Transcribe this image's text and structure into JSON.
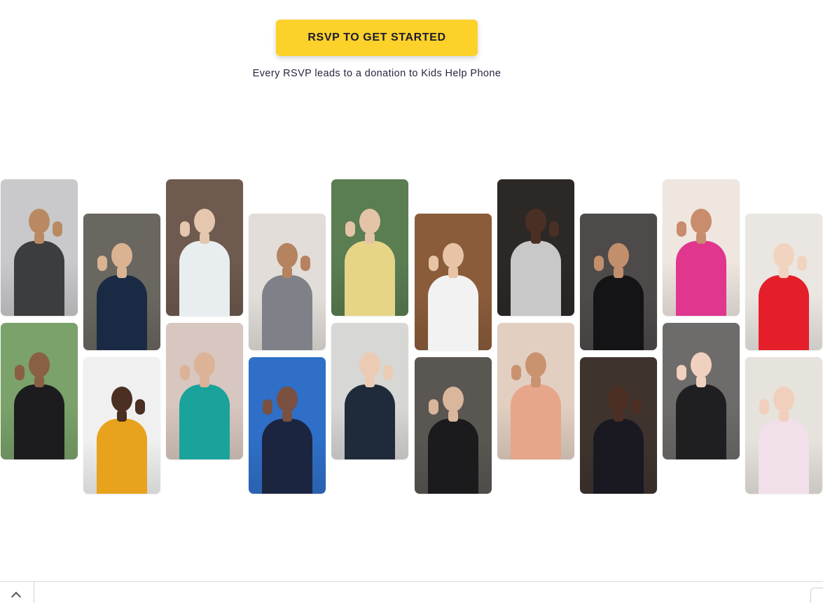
{
  "cta": {
    "label": "RSVP TO GET STARTED"
  },
  "tagline": "Every RSVP leads to a donation to Kids Help Phone",
  "gallery": {
    "photos": [
      {
        "name": "photo-guy-waving-vest",
        "bg": "#c9c9cb",
        "skin": "#b98a62",
        "outfit": "#3b3d3f"
      },
      {
        "name": "photo-girl-black-gown",
        "bg": "#7aa26a",
        "skin": "#8a5f44",
        "outfit": "#1c1c1e"
      },
      {
        "name": "photo-guy-navy-tux",
        "bg": "#6a6660",
        "skin": "#d9b392",
        "outfit": "#1b2a44"
      },
      {
        "name": "photo-girl-striped-blazer",
        "bg": "#f0f0f0",
        "skin": "#4a2f22",
        "outfit": "#e8a21b"
      },
      {
        "name": "photo-girl-white-gown",
        "bg": "#6e5a4e",
        "skin": "#e5c6ae",
        "outfit": "#e8eef0"
      },
      {
        "name": "photo-girl-teal-dress",
        "bg": "#d8c7c0",
        "skin": "#dcb396",
        "outfit": "#1aa39a"
      },
      {
        "name": "photo-guy-grey-suit",
        "bg": "#e2ddd8",
        "skin": "#b5835f",
        "outfit": "#7e8188"
      },
      {
        "name": "photo-girl-navy-dress-sky",
        "bg": "#2f6fc7",
        "skin": "#7a5040",
        "outfit": "#1c2540"
      },
      {
        "name": "photo-girl-floral-gown",
        "bg": "#5a7d52",
        "skin": "#e4c4a6",
        "outfit": "#e6d586"
      },
      {
        "name": "photo-girl-sequin-top",
        "bg": "#d7d7d5",
        "skin": "#eccbb5",
        "outfit": "#1f2a3b"
      },
      {
        "name": "photo-person-suspenders",
        "bg": "#8a5c3a",
        "skin": "#e8c4a6",
        "outfit": "#f2f2f2"
      },
      {
        "name": "photo-guy-black-suit-mirror",
        "bg": "#5a5652",
        "skin": "#d9b69c",
        "outfit": "#1b1b1d"
      },
      {
        "name": "photo-guy-white-hat",
        "bg": "#2c2826",
        "skin": "#4a3024",
        "outfit": "#c9c8c8"
      },
      {
        "name": "photo-girl-peach-gown",
        "bg": "#e2cfc2",
        "skin": "#c99370",
        "outfit": "#e7a58a"
      },
      {
        "name": "photo-girl-black-vneck",
        "bg": "#4e4a4a",
        "skin": "#c28f6c",
        "outfit": "#141416"
      },
      {
        "name": "photo-girl-jeweled-gown",
        "bg": "#3f332e",
        "skin": "#4c2e22",
        "outfit": "#1a1922"
      },
      {
        "name": "photo-girl-pink-saree",
        "bg": "#efe6e0",
        "skin": "#c98c6c",
        "outfit": "#e0368e"
      },
      {
        "name": "photo-guy-curly-hair",
        "bg": "#6e6c6a",
        "skin": "#f0d0be",
        "outfit": "#1f1f22"
      },
      {
        "name": "photo-girl-red-dress",
        "bg": "#eae6e2",
        "skin": "#f1d4c0",
        "outfit": "#e41f2a"
      },
      {
        "name": "photo-girl-sparkle-gown",
        "bg": "#e6e2dc",
        "skin": "#f0d0bc",
        "outfit": "#f1e0ea"
      }
    ]
  }
}
